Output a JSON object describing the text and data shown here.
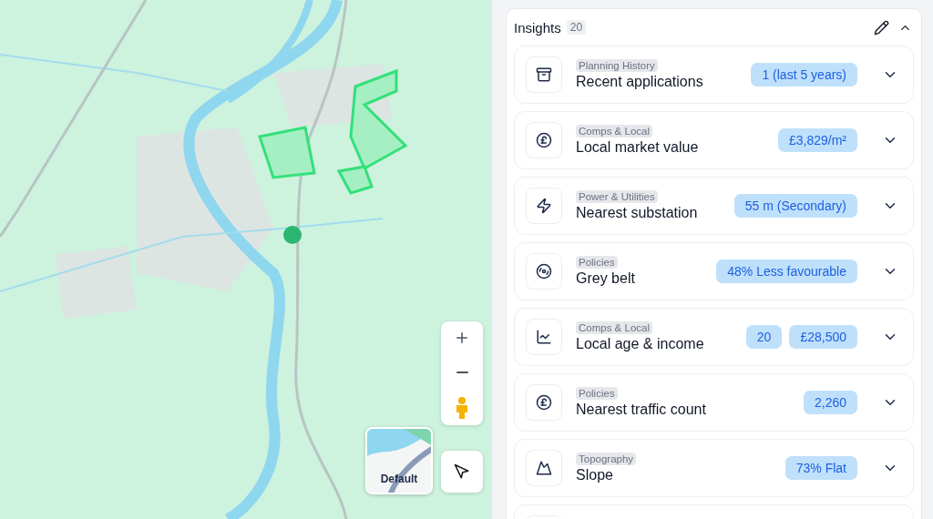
{
  "map": {
    "layer_button": {
      "label": "Default"
    }
  },
  "insights": {
    "title": "Insights",
    "count": "20",
    "expanded": true,
    "items": [
      {
        "kind": "archive",
        "category": "Planning History",
        "title": "Recent applications",
        "badges": [
          "1 (last 5 years)"
        ]
      },
      {
        "kind": "pound",
        "category": "Comps & Local",
        "title": "Local market value",
        "badges": [
          "£3,829/m²"
        ]
      },
      {
        "kind": "substation",
        "category": "Power & Utilities",
        "title": "Nearest substation",
        "badges": [
          "55 m (Secondary)"
        ]
      },
      {
        "kind": "belt",
        "category": "Policies",
        "title": "Grey belt",
        "badges": [
          "48% Less favourable"
        ]
      },
      {
        "kind": "chart",
        "category": "Comps & Local",
        "title": "Local age & income",
        "badges": [
          "20",
          "£28,500"
        ]
      },
      {
        "kind": "pound",
        "category": "Policies",
        "title": "Nearest traffic count",
        "badges": [
          "2,260"
        ]
      },
      {
        "kind": "terrain",
        "category": "Topography",
        "title": "Slope",
        "badges": [
          "73% Flat"
        ]
      }
    ]
  }
}
